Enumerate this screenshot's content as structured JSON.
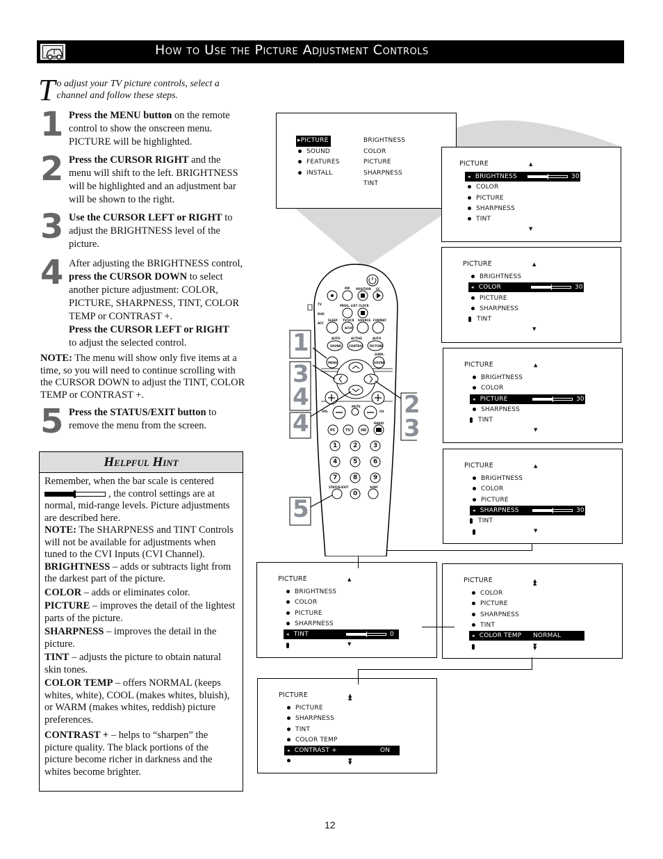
{
  "header": {
    "title": "How to Use the Picture Adjustment Controls",
    "icon": "tv-car-icon"
  },
  "intro": {
    "dropcap": "T",
    "text": "o adjust your TV picture controls, select a channel and follow these steps."
  },
  "steps": [
    {
      "num": "1",
      "bold": "Press the MENU button",
      "text": " on the remote control to show the onscreen menu. PICTURE will be highlighted."
    },
    {
      "num": "2",
      "bold": "Press the CURSOR RIGHT",
      "text": " and the menu will shift to the left. BRIGHTNESS will be highlighted and an adjustment bar will be shown to the right."
    },
    {
      "num": "3",
      "bold": "Use the CURSOR LEFT or RIGHT",
      "text": " to adjust the BRIGHTNESS level of the picture."
    },
    {
      "num": "4",
      "pre": "After adjusting the BRIGHTNESS control, ",
      "bold": "press the CURSOR DOWN",
      "text": " to select another picture adjustment: COLOR, PICTURE, SHARPNESS, TINT, COLOR TEMP  or CONTRAST +.",
      "bold2": "Press the CURSOR LEFT or RIGHT",
      "text2": " to adjust the selected control."
    },
    {
      "num": "5",
      "bold": "Press the STATUS/EXIT button",
      "text": " to remove the menu from the screen."
    }
  ],
  "note": {
    "label": "NOTE:",
    "text": "  The menu will show only five items at a time, so you will need to continue scrolling with the CURSOR DOWN to adjust the TINT, COLOR TEMP or CONTRAST +."
  },
  "hint": {
    "title": "Helpful Hint",
    "bar_position": 0.5,
    "intro_a": "Remember, when the bar scale is centered",
    "intro_b": ", the control settings are at normal, mid-range levels. Picture adjustments are described here.",
    "note_label": "NOTE:",
    "note_text": " The SHARPNESS and TINT Controls will not be available for adjustments when tuned to the CVI Inputs (CVI Channel).",
    "items": [
      {
        "term": "BRIGHTNESS",
        "desc": " – adds or subtracts light from the darkest part of the picture."
      },
      {
        "term": "COLOR",
        "desc": " – adds or eliminates color."
      },
      {
        "term": "PICTURE",
        "desc": " – improves the detail of the lightest parts of the picture."
      },
      {
        "term": "SHARPNESS",
        "desc": " – improves the detail in the picture."
      },
      {
        "term": "TINT",
        "desc": " – adjusts the picture to obtain natural skin tones."
      },
      {
        "term": "COLOR TEMP",
        "desc": " – offers NORMAL (keeps whites, white), COOL (makes whites, bluish), or WARM (makes whites, reddish) picture preferences."
      },
      {
        "term": "CONTRAST +",
        "desc": " – helps to “sharpen” the picture quality. The black portions of the picture become richer in darkness and the whites become brighter."
      }
    ]
  },
  "main_menu": {
    "left": [
      "PICTURE",
      "SOUND",
      "FEATURES",
      "INSTALL"
    ],
    "right": [
      "BRIGHTNESS",
      "COLOR",
      "PICTURE",
      "SHARPNESS",
      "TINT"
    ],
    "selected": "PICTURE"
  },
  "screens": [
    {
      "title": "PICTURE",
      "items": [
        "BRIGHTNESS",
        "COLOR",
        "PICTURE",
        "SHARPNESS",
        "TINT"
      ],
      "selected": 0,
      "value": "30",
      "slider": 0.5,
      "more": false
    },
    {
      "title": "PICTURE",
      "items": [
        "BRIGHTNESS",
        "COLOR",
        "PICTURE",
        "SHARPNESS",
        "TINT"
      ],
      "selected": 1,
      "value": "30",
      "slider": 0.5,
      "more": true
    },
    {
      "title": "PICTURE",
      "items": [
        "BRIGHTNESS",
        "COLOR",
        "PICTURE",
        "SHARPNESS",
        "TINT"
      ],
      "selected": 2,
      "value": "30",
      "slider": 0.5,
      "more": true
    },
    {
      "title": "PICTURE",
      "items": [
        "BRIGHTNESS",
        "COLOR",
        "PICTURE",
        "SHARPNESS",
        "TINT"
      ],
      "selected": 3,
      "value": "30",
      "slider": 0.5,
      "more": true
    },
    {
      "title": "PICTURE",
      "items": [
        "BRIGHTNESS",
        "COLOR",
        "PICTURE",
        "SHARPNESS",
        "TINT"
      ],
      "selected": 4,
      "value": "0",
      "slider": 0.5,
      "more": true
    },
    {
      "title": "PICTURE",
      "items": [
        "COLOR",
        "PICTURE",
        "SHARPNESS",
        "TINT",
        "COLOR TEMP"
      ],
      "selected": 4,
      "value": "NORMAL",
      "more": true
    },
    {
      "title": "PICTURE",
      "items": [
        "PICTURE",
        "SHARPNESS",
        "TINT",
        "COLOR TEMP",
        "CONTRAST +"
      ],
      "selected": 4,
      "value": "ON",
      "more": true
    }
  ],
  "remote": {
    "labels": {
      "pip": "PIP",
      "position": "POSITION",
      "cc": "CC",
      "prog_list": "PROG. LIST",
      "clock": "CLOCK",
      "tv": "TV",
      "dvd": "DVD",
      "acc": "ACC",
      "sleep": "SLEEP",
      "tvvcr": "TV/VCR",
      "source": "SOURCE",
      "format": "FORMAT",
      "ach": "A/CH",
      "auto1": "AUTO",
      "active": "ACTIVE",
      "auto2": "AUTO",
      "sound": "SOUND",
      "control": "CONTROL",
      "picture": "PICTURE",
      "surr": "SURR.",
      "menu": "MENU",
      "sound2": "SOUND",
      "vol": "VOL",
      "mute": "MUTE",
      "ch": "CH",
      "radio": "RADIO",
      "pc": "PC",
      "tvbtn": "TV",
      "hd": "HD",
      "status_exit": "STATUS/EXIT",
      "surf": "SURF",
      "digits": [
        "1",
        "2",
        "3",
        "4",
        "5",
        "6",
        "7",
        "8",
        "9",
        "0"
      ]
    },
    "callouts": [
      "1",
      "3",
      "4",
      "4",
      "2",
      "3",
      "5"
    ]
  },
  "page_number": "12"
}
